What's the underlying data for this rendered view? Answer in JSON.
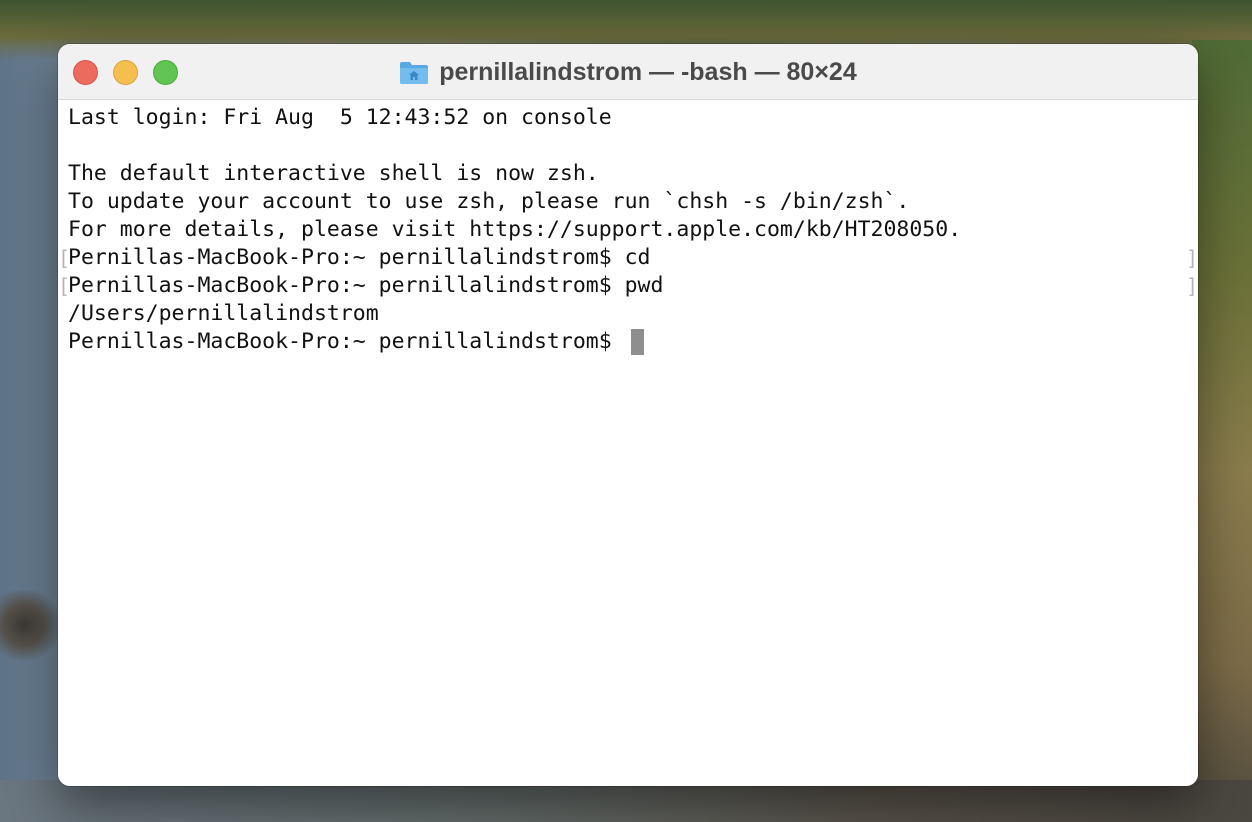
{
  "window": {
    "title": "pernillalindstrom — -bash — 80×24",
    "traffic_lights": {
      "close_color": "#ed6a5e",
      "minimize_color": "#f5bf4f",
      "zoom_color": "#61c554"
    },
    "title_icon": "home-folder-icon"
  },
  "terminal": {
    "lines": [
      "Last login: Fri Aug  5 12:43:52 on console",
      "",
      "The default interactive shell is now zsh.",
      "To update your account to use zsh, please run `chsh -s /bin/zsh`.",
      "For more details, please visit https://support.apple.com/kb/HT208050.",
      "Pernillas-MacBook-Pro:~ pernillalindstrom$ cd",
      "Pernillas-MacBook-Pro:~ pernillalindstrom$ pwd",
      "/Users/pernillalindstrom",
      "Pernillas-MacBook-Pro:~ pernillalindstrom$ "
    ],
    "mark_open": "[",
    "mark_close": "]"
  }
}
